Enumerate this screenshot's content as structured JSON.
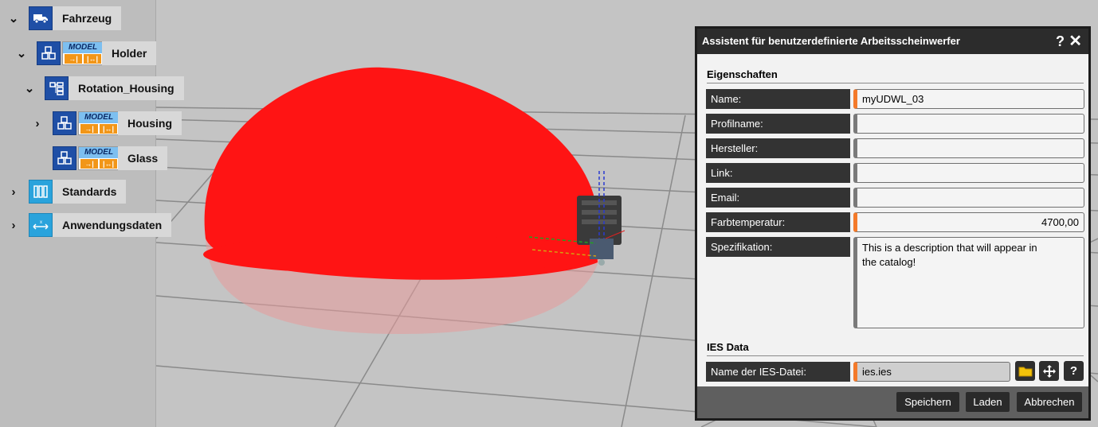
{
  "tree": {
    "fahrzeug": "Fahrzeug",
    "holder": "Holder",
    "rotation_housing": "Rotation_Housing",
    "housing": "Housing",
    "glass": "Glass",
    "standards": "Standards",
    "anwendungsdaten": "Anwendungsdaten",
    "model_badge": "MODEL"
  },
  "dialog": {
    "title": "Assistent für benutzerdefinierte Arbeitsscheinwerfer",
    "help": "?",
    "close": "✕",
    "section_properties": "Eigenschaften",
    "section_ies": "IES Data",
    "labels": {
      "name": "Name:",
      "profile": "Profilname:",
      "manufacturer": "Hersteller:",
      "link": "Link:",
      "email": "Email:",
      "color_temp": "Farbtemperatur:",
      "spec": "Spezifikation:",
      "ies_file": "Name der IES-Datei:"
    },
    "values": {
      "name": "myUDWL_03",
      "profile": "",
      "manufacturer": "",
      "link": "",
      "email": "",
      "color_temp": "4700,00",
      "spec": "This is a description that will appear in\nthe catalog!",
      "ies_file": "ies.ies"
    },
    "buttons": {
      "save": "Speichern",
      "load": "Laden",
      "cancel": "Abbrechen",
      "help_small": "?"
    }
  },
  "colors": {
    "accent": "#f47a2a",
    "dome": "#ff1414",
    "tile_blue": "#1f4fa6",
    "tile_cyan": "#2aa3dc"
  }
}
